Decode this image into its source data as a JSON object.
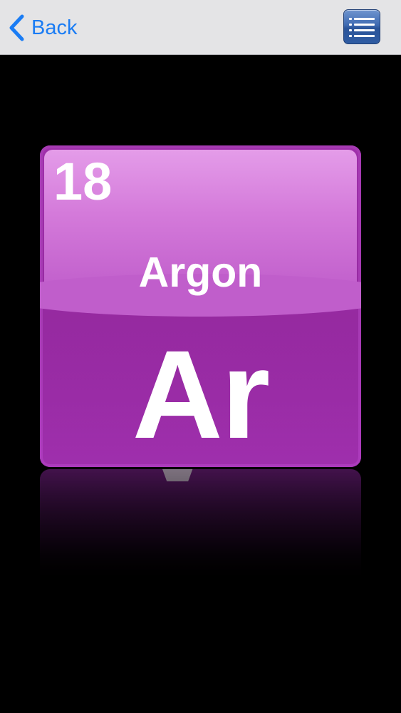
{
  "navbar": {
    "back_label": "Back",
    "accent_color": "#1a7cf4",
    "back_icon": "chevron-left-icon",
    "menu_icon": "list-icon"
  },
  "element": {
    "atomic_number": "18",
    "name": "Argon",
    "symbol": "Ar",
    "tile_color": "#9f2fab"
  }
}
